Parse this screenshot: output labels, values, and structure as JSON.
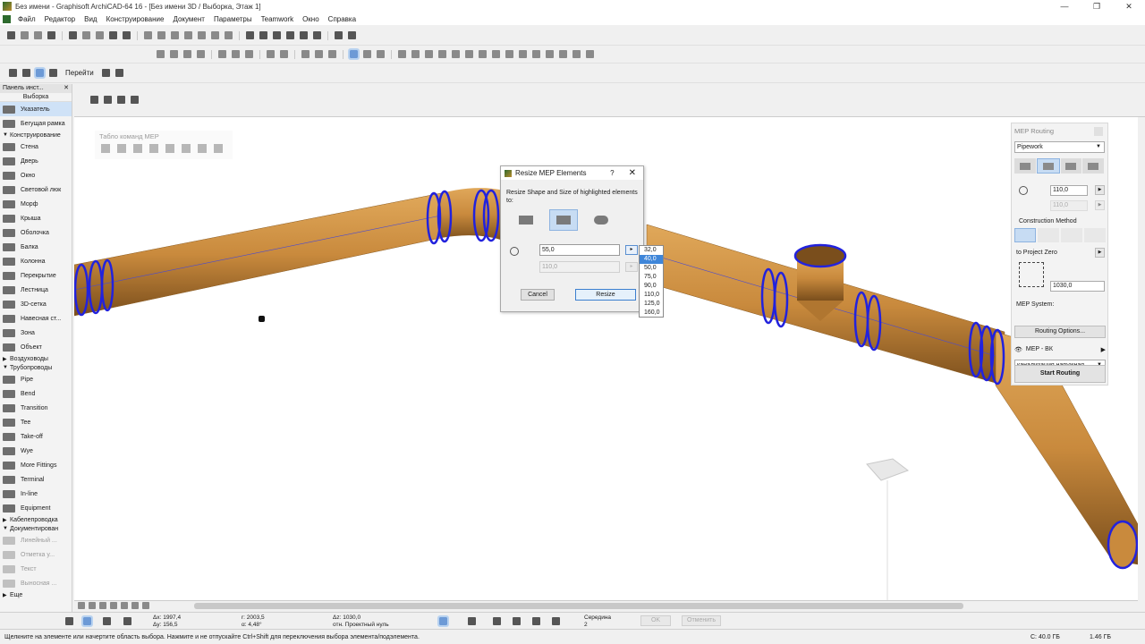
{
  "window": {
    "title": "Без имени - Graphisoft ArchiCAD-64 16 - [Без имени 3D / Выборка, Этаж 1]",
    "controls": [
      "—",
      "❐",
      "✕"
    ]
  },
  "menubar": {
    "items": [
      "Файл",
      "Редактор",
      "Вид",
      "Конструирование",
      "Документ",
      "Параметры",
      "Teamwork",
      "Окно",
      "Справка"
    ]
  },
  "toolbar3": {
    "goto_label": "Перейти"
  },
  "toolbox": {
    "header": "Панель инст...",
    "close": "✕",
    "subheader": "Выборка",
    "pointer": "Указатель",
    "marquee": "Бегущая рамка",
    "group_design": "Конструирование",
    "design_items": [
      "Стена",
      "Дверь",
      "Окно",
      "Световой люк",
      "Морф",
      "Крыша",
      "Оболочка",
      "Балка",
      "Колонна",
      "Перекрытие",
      "Лестница",
      "3D-сетка",
      "Навесная ст...",
      "Зона",
      "Объект"
    ],
    "group_ducts": "Воздуховоды",
    "group_pipes": "Трубопроводы",
    "pipe_items": [
      "Pipe",
      "Bend",
      "Transition",
      "Tee",
      "Take-off",
      "Wye",
      "More Fittings",
      "Terminal",
      "In-line",
      "Equipment"
    ],
    "group_cables": "Кабелепроводка",
    "group_docs": "Документирован",
    "doc_items": [
      "Линейный ...",
      "Отметка у...",
      "Текст",
      "Выносная ..."
    ],
    "more": "Еще"
  },
  "mep_palette": {
    "title": "Табло команд MEP"
  },
  "dialog": {
    "title": "Resize MEP Elements",
    "help": "?",
    "close": "✕",
    "message": "Resize Shape and Size of  highlighted elements to:",
    "value1": "55,0",
    "value2": "110,0",
    "arrow": "▸",
    "cancel": "Cancel",
    "resize": "Resize"
  },
  "size_dropdown": {
    "options": [
      "32,0",
      "40,0",
      "50,0",
      "75,0",
      "90,0",
      "110,0",
      "125,0",
      "160,0"
    ],
    "highlighted": "40,0"
  },
  "routing_panel": {
    "title": "MEP Routing",
    "type_select": "Pipework",
    "size_value": "110,0",
    "size_value2": "110,0",
    "construction_method": "Construction Method",
    "to_project_zero": "to Project Zero",
    "elevation": "1030,0",
    "mep_system_label": "MEP System:",
    "mep_system_value": "канализация наружная",
    "routing_options": "Routing Options...",
    "layer": "MEP - ВК",
    "start_routing": "Start Routing"
  },
  "infobar": {
    "dx": "Δx: 1997,4",
    "dy": "Δy: 156,5",
    "r": "r: 2003,5",
    "a": "α: 4,48°",
    "dz": "Δz: 1030,0",
    "ref": "отн. Проектный нуль",
    "snap": "Середина",
    "snap_num": "2",
    "ok": "OK",
    "cancel": "Отменить"
  },
  "statusbar": {
    "hint": "Щелкните на элементе или начертите область выбора. Нажмите и не отпускайте Ctrl+Shift для переключения выбора элемента/подэлемента.",
    "disk_c": "C: 40.0 ГБ",
    "mem": "1.46 ГБ"
  },
  "colors": {
    "pipe_fill": "#c98a3d",
    "pipe_highlight": "#2222dd",
    "selection_blue": "#3f86d9"
  }
}
